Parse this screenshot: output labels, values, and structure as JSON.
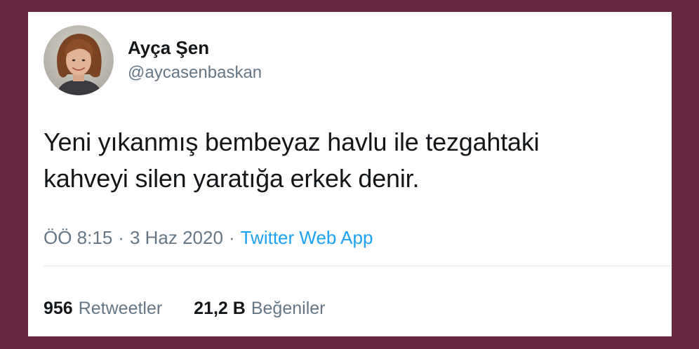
{
  "tweet": {
    "author": {
      "display_name": "Ayça Şen",
      "handle": "@aycasenbaskan",
      "avatar_icon": "profile-photo"
    },
    "text_lines": [
      "Yeni yıkanmış bembeyaz havlu ile tezgahtaki",
      "kahveyi silen yaratığa erkek denir."
    ],
    "time": "ÖÖ 8:15",
    "date": "3 Haz 2020",
    "separator": "·",
    "source": "Twitter Web App",
    "stats": {
      "retweets": {
        "count": "956",
        "label": "Retweetler"
      },
      "likes": {
        "count": "21,2 B",
        "label": "Beğeniler"
      }
    }
  },
  "colors": {
    "frame": "#662840",
    "card": "#ffffff",
    "text_primary": "#14171a",
    "text_secondary": "#657786",
    "link": "#1da1f2",
    "divider": "#e1e8ed"
  }
}
